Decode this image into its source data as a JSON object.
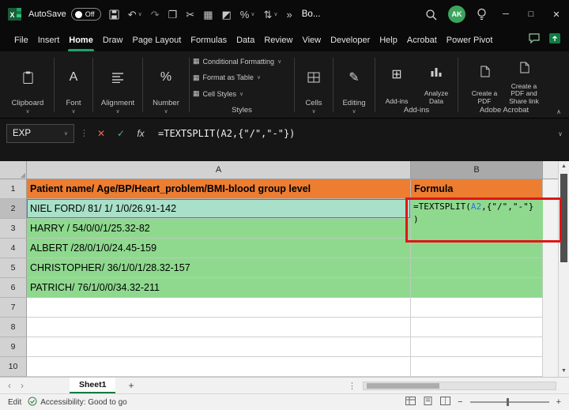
{
  "titlebar": {
    "autosave_label": "AutoSave",
    "autosave_state": "Off",
    "doc_title": "Bo...",
    "avatar": "AK"
  },
  "ribbon_tabs": {
    "items": [
      "File",
      "Insert",
      "Home",
      "Draw",
      "Page Layout",
      "Formulas",
      "Data",
      "Review",
      "View",
      "Developer",
      "Help",
      "Acrobat",
      "Power Pivot"
    ]
  },
  "ribbon": {
    "clipboard": "Clipboard",
    "font": "Font",
    "alignment": "Alignment",
    "number": "Number",
    "styles_items": [
      "Conditional Formatting",
      "Format as Table",
      "Cell Styles"
    ],
    "styles_label": "Styles",
    "cells": "Cells",
    "editing": "Editing",
    "addins_buttons": [
      "Add-ins",
      "Analyze Data"
    ],
    "addins_label": "Add-ins",
    "acrobat_buttons": [
      "Create a PDF",
      "Create a PDF and Share link"
    ],
    "acrobat_label": "Adobe Acrobat"
  },
  "formula_bar": {
    "name_box": "EXP",
    "formula": "=TEXTSPLIT(A2,{\"/\",\"-\"})"
  },
  "grid": {
    "col_headers": [
      "A",
      "B"
    ],
    "row_numbers": [
      "1",
      "2",
      "3",
      "4",
      "5",
      "6",
      "7",
      "8",
      "9",
      "10"
    ],
    "a_values": [
      "Patient name/ Age/BP/Heart_problem/BMI-blood group level",
      "NIEL FORD/ 81/ 1/ 1/0/26.91-142",
      "HARRY / 54/0/0/1/25.32-82",
      "ALBERT /28/0/1/0/24.45-159",
      "CHRISTOPHER/ 36/1/0/1/28.32-157",
      "PATRICH/ 76/1/0/0/34.32-211",
      "",
      "",
      "",
      ""
    ],
    "b_header": "Formula",
    "b2": {
      "prefix": "=TEXTSPLIT(",
      "ref": "A2",
      "mid": ",{\"/\",\"-\"}",
      "close": ")"
    }
  },
  "sheet_bar": {
    "tab": "Sheet1"
  },
  "status_bar": {
    "mode": "Edit",
    "accessibility": "Accessibility: Good to go"
  },
  "icons": {
    "caret_down": "∨",
    "undo": "↶",
    "redo": "↷",
    "copy": "❐",
    "cut": "✂",
    "picture": "▦",
    "paint": "◩",
    "percent": "%",
    "sort": "⇅",
    "overflow": "»",
    "dots": "⋮",
    "minimize": "─",
    "maximize": "□",
    "close": "✕",
    "cancel": "✕",
    "check": "✓",
    "fx": "fx",
    "expand": "∨",
    "collapse": "∧",
    "up": "▲",
    "down": "▼",
    "prev": "‹",
    "next": "›",
    "plus": "+",
    "minus": "−",
    "corner_triangle": "◢",
    "editing_glyph": "✎",
    "addins_glyph": "⊞",
    "font_glyph": "A",
    "number_glyph": "%",
    "style_square": "▦"
  },
  "colors": {
    "accent_green": "#21A366",
    "excel_green": "#107C41",
    "header_orange": "#ED7D31",
    "cell_green": "#8FD98F",
    "cell_teal": "#A9E0C9",
    "annotation_red": "#E01515",
    "ref_blue": "#2E74D9",
    "avatar_green": "#3BA55D"
  }
}
